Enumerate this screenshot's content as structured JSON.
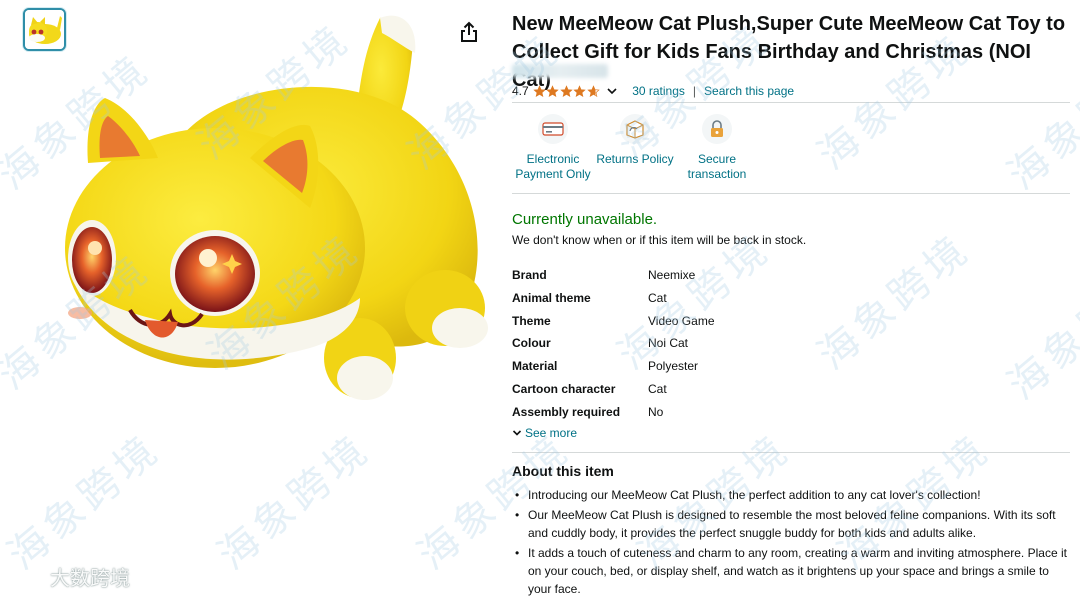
{
  "product": {
    "title": "New MeeMeow Cat Plush,Super Cute MeeMeow Cat Toy to Collect Gift for Kids Fans Birthday and Christmas (NOI Cat)",
    "rating_value": "4.7",
    "rating_stars": 4.7,
    "ratings_link": "30 ratings",
    "separator": "|",
    "search_link": "Search this page"
  },
  "badges": [
    {
      "label_line1": "Electronic",
      "label_line2": "Payment Only",
      "icon": "card-icon"
    },
    {
      "label_line1": "Returns Policy",
      "label_line2": "",
      "icon": "return-box-icon"
    },
    {
      "label_line1": "Secure",
      "label_line2": "transaction",
      "icon": "lock-icon"
    }
  ],
  "availability": {
    "status": "Currently unavailable.",
    "note": "We don't know when or if this item will be back in stock."
  },
  "specs": [
    {
      "key": "Brand",
      "value": "Neemixe"
    },
    {
      "key": "Animal theme",
      "value": "Cat"
    },
    {
      "key": "Theme",
      "value": "Video Game"
    },
    {
      "key": "Colour",
      "value": "Noi Cat"
    },
    {
      "key": "Material",
      "value": "Polyester"
    },
    {
      "key": "Cartoon character",
      "value": "Cat"
    },
    {
      "key": "Assembly required",
      "value": "No"
    }
  ],
  "see_more": "See more",
  "about": {
    "title": "About this item",
    "bullets": [
      "Introducing our MeeMeow Cat Plush, the perfect addition to any cat lover's collection!",
      "Our MeeMeow Cat Plush is designed to resemble the most beloved feline companions. With its soft and cuddly body, it provides the perfect snuggle buddy for both kids and adults alike.",
      "It adds a touch of cuteness and charm to any room, creating a warm and inviting atmosphere. Place it on your couch, bed, or display shelf, and watch as it brightens up your space and brings a smile to your face."
    ]
  },
  "watermark": {
    "text": "海象跨境",
    "corner_text": "大数跨境"
  },
  "colors": {
    "link": "#007185",
    "available_green": "#007600",
    "star": "#de7921",
    "plush_yellow": "#f7e01a"
  }
}
